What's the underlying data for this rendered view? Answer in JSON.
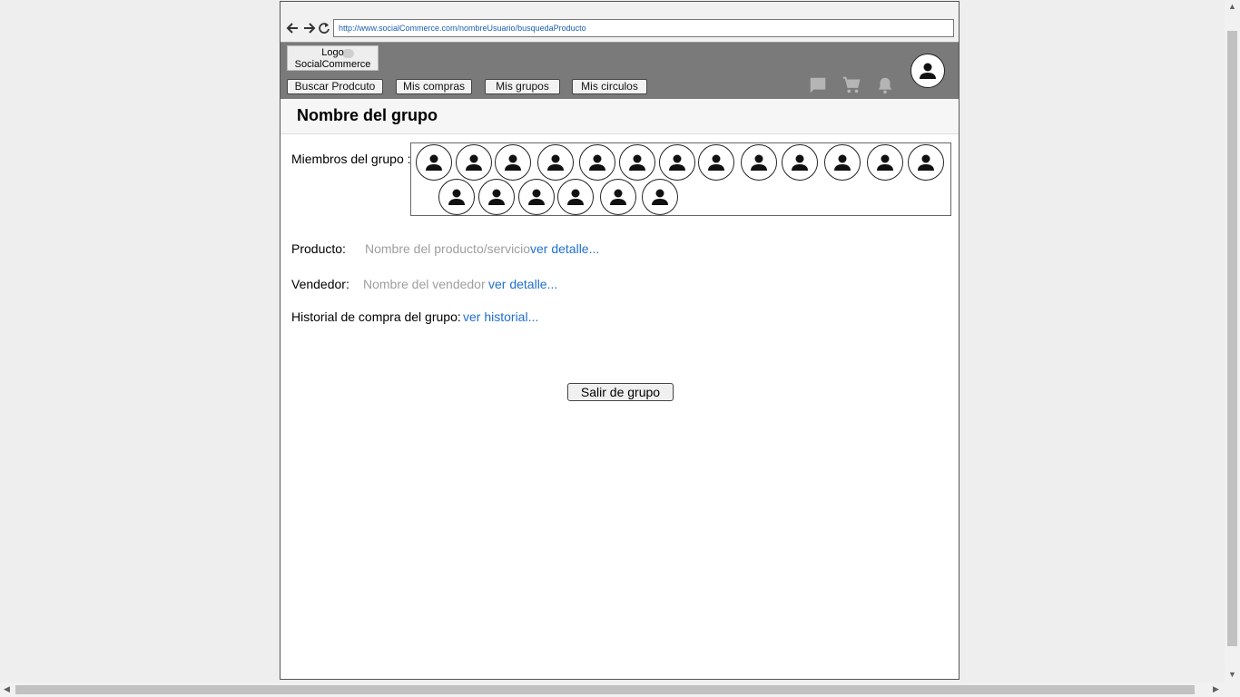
{
  "browser": {
    "url": "http://www.socialCommerce.com/nombreUsuario/busquedaProducto"
  },
  "header": {
    "logo_line1": "Logo",
    "logo_line2": "SocialCommerce",
    "nav": [
      {
        "label": "Buscar Prodcuto"
      },
      {
        "label": "Mis compras"
      },
      {
        "label": "Mis grupos"
      },
      {
        "label": "Mis circulos"
      }
    ],
    "icons": [
      "chat-icon",
      "cart-icon",
      "bell-icon",
      "user-avatar-icon"
    ]
  },
  "page": {
    "title": "Nombre del grupo"
  },
  "members": {
    "label": "Miembros del grupo :",
    "count": 19
  },
  "product": {
    "label": "Producto:",
    "value": "Nombre del producto/servicio",
    "link": "ver detalle..."
  },
  "seller": {
    "label": "Vendedor:",
    "value": "Nombre del vendedor",
    "link": "ver detalle..."
  },
  "history": {
    "label": "Historial de compra del grupo:",
    "link": "ver historial..."
  },
  "actions": {
    "leave_label": "Salir de grupo"
  },
  "colors": {
    "header_bg": "#7a7a7a",
    "link": "#1f6fcf",
    "muted": "#9e9e9e"
  }
}
